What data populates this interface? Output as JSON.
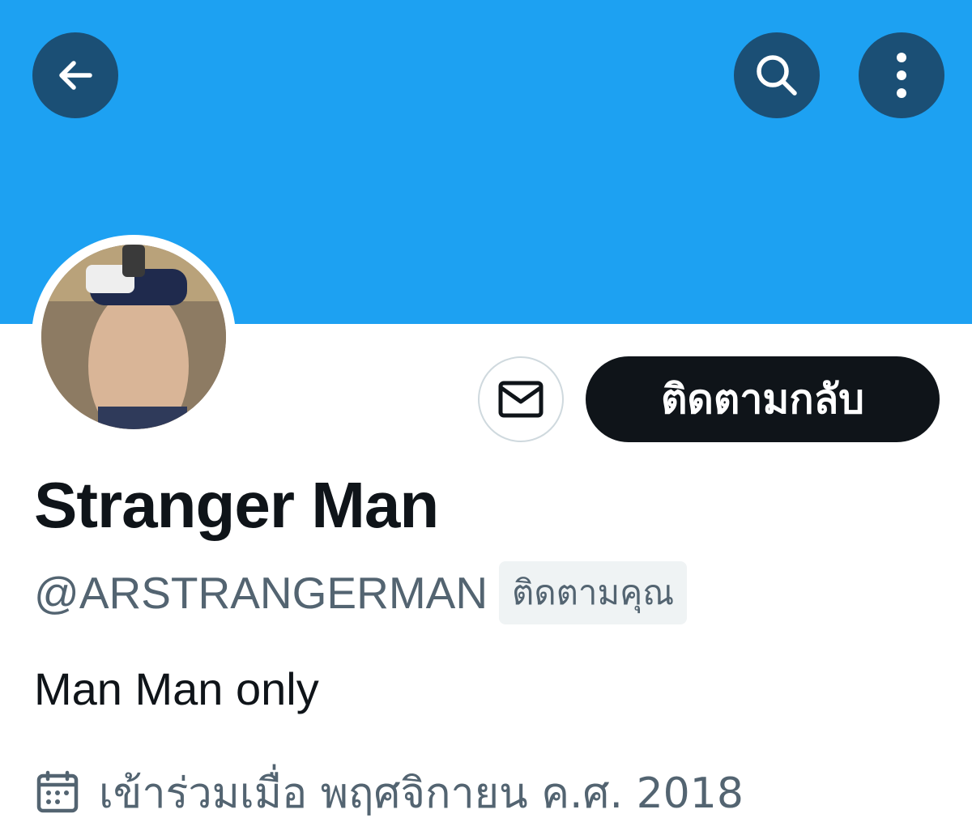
{
  "header": {
    "back_icon": "arrow-left-icon",
    "search_icon": "search-icon",
    "more_icon": "more-vertical-icon",
    "banner_color": "#1da1f2"
  },
  "profile": {
    "display_name": "Stranger Man",
    "handle": "@ARSTRANGERMAN",
    "follows_you_label": "ติดตามคุณ",
    "bio": "Man Man only",
    "joined_text": "เข้าร่วมเมื่อ พฤศจิกายน ค.ศ. 2018",
    "joined_icon": "calendar-icon"
  },
  "actions": {
    "message_icon": "envelope-icon",
    "follow_back_label": "ติดตามกลับ"
  },
  "colors": {
    "primary_text": "#0f1419",
    "secondary_text": "#536471",
    "header_button": "#1b4f75"
  }
}
